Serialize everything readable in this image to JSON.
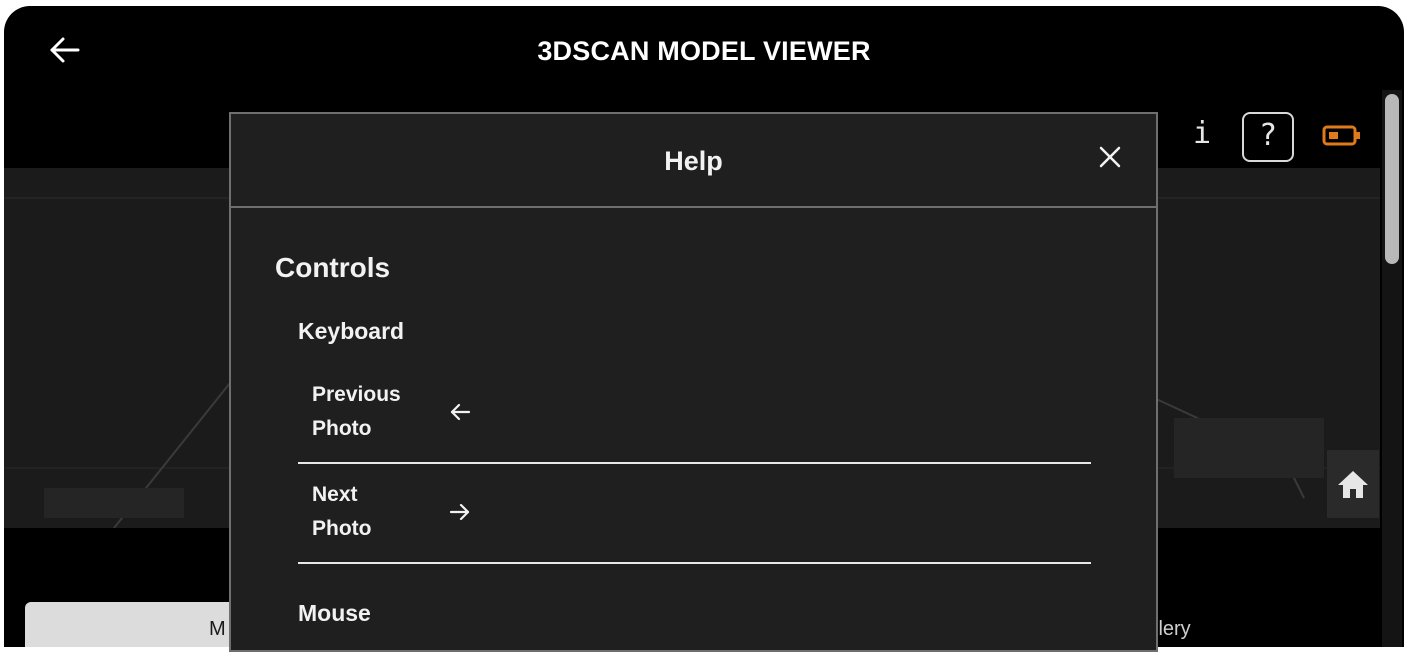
{
  "app": {
    "title": "3DSCAN MODEL VIEWER"
  },
  "toolbar": {
    "info_label": "i",
    "help_label": "?",
    "battery_color": "#e07a1a"
  },
  "tabs": {
    "left_label": "M",
    "right_label": "llery"
  },
  "dialog": {
    "title": "Help",
    "section_title": "Controls",
    "keyboard_heading": "Keyboard",
    "keyboard_rows": [
      {
        "line1": "Previous",
        "line2": "Photo",
        "key_icon": "arrow-left-icon"
      },
      {
        "line1": "Next",
        "line2": "Photo",
        "key_icon": "arrow-right-icon"
      }
    ],
    "mouse_heading": "Mouse"
  }
}
